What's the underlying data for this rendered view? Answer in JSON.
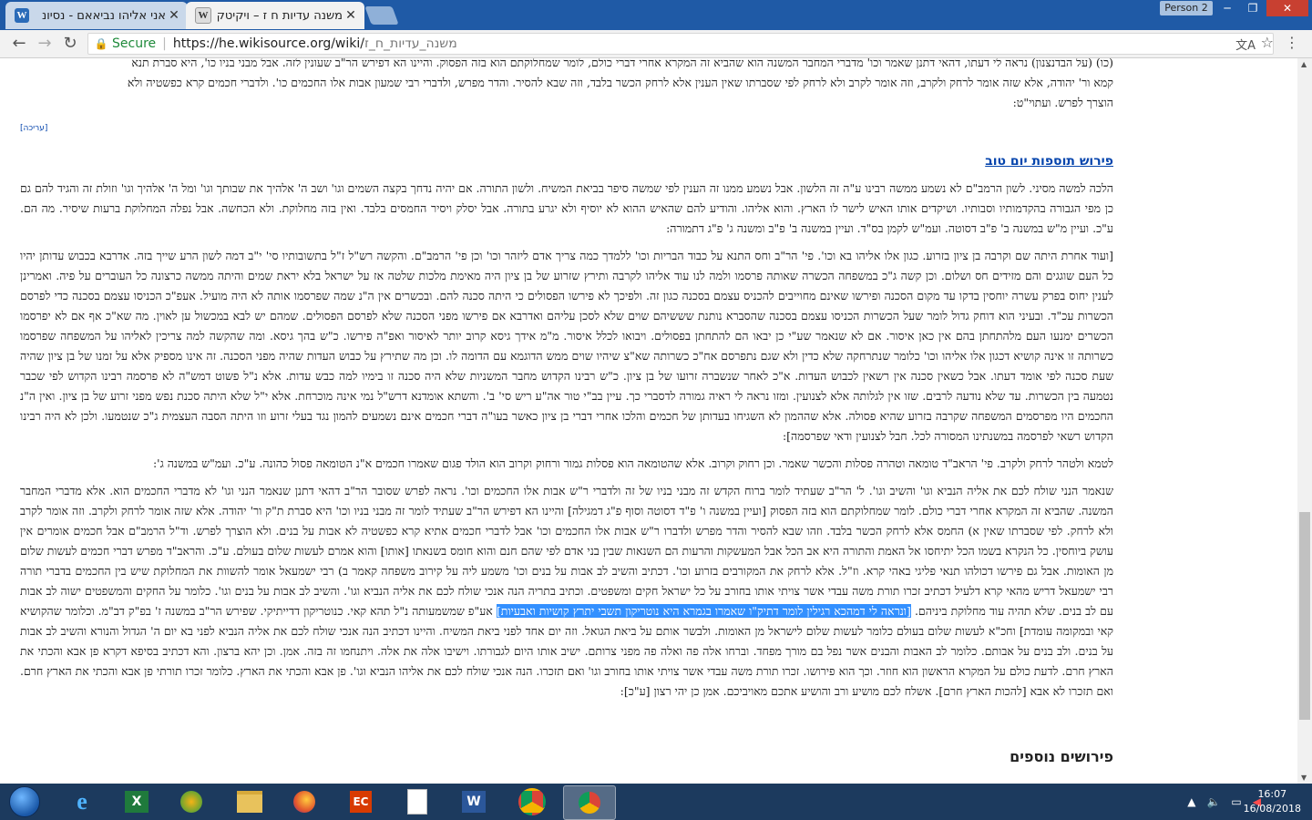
{
  "browser": {
    "tabs": [
      {
        "title": "אני אליהו נביאאם - נסיונ",
        "favicon": "W"
      },
      {
        "title": "משנה עדיות ח ז – ויקיטקסט",
        "favicon": "W"
      }
    ],
    "profile": "Person 2",
    "secure_label": "Secure",
    "url_host": "https://he.wikisource.org/wiki/",
    "url_path": "משנה_עדיות_ח_ז"
  },
  "content": {
    "intro_lines": [
      "(כו) (על הבדנצנון) נראה לי דעתו, דהאי דתנן שאמר וכו' מדברי המחבר המשנה הוא שהביא זה המקרא אחרי דברי כולם, לומר שמחלוקתם הוא בזה הפסוק. והיינו הא דפירש הר\"ב שעונין לזה. אבל מבני בניו כו', היא סברת תנא",
      "קמא ור' יהודה, אלא שזה אומר לרחק ולקרב, וזה אומר לקרב ולא לרחק לפי שסברתו שאין הענין אלא לרחק הכשר בלבד, וזה שבא להסיר. והדר מפרש, ולדברי רבי שמעון אבות אלו החכמים כו'. ולדברי חכמים קרא כפשטיה ולא",
      "הוצרך לפרש. ועתוי\"ט:"
    ],
    "edit_link": "[עריכה]",
    "heading": "פירוש תוספות יום טוב",
    "para1": "הלכה למשה מסיני. לשון הרמב\"ם לא נשמע ממשה רבינו ע\"ה זה הלשון. אבל נשמע ממנו זה הענין לפי שמשה סיפר בביאת המשיח. ולשון התורה. אם יהיה נדחך בקצה השמים וגו' ושב ה' אלהיך את שבותך וגו' ומל ה' אלהיך וגו' וזולת זה והגיד להם גם כן מפי הגבורה בהקדמותיו וסבותיו. ושיקדים אותו האיש לישר לו הארץ. והוא אליהו. והודיע להם שהאיש ההוא לא יוסיף ולא יגרע בתורה. אבל יסלק ויסיר החמסים בלבד. ואין בזה מחלוקת. ולא הכחשה. אבל נפלה המחלוקת ברעות שיסיר. מה הם. ע\"כ. ועיין מ\"ש במשנה ב' פ\"ב דסוטה. ועמ\"ש לקמן בס\"ד. ועיין במשנה ב' פ\"ב ומשנה ג' פ\"ג דתמורה:",
    "para2": "[ועוד אחרת היתה שם וקרבה בן ציון בזרוע. כגון אלו אליהו בא וכו'. פי' הר\"ב וחס התנא על כבוד הבריות וכו' ללמדך כמה צריך אדם ליזהר וכו' וכן פי' הרמב\"ם. והקשה רש\"ל ז\"ל בתשובותיו סי' י\"ב דמה לשון הרע שייך בזה. אדרבא בכבוש עדותן יהיו כל העם שוגגים והם מזידים חס ושלום. וכן קשה ג\"כ במשפחה הכשרה שאותה פרסמו ולמה לנו עוד אליהו לקרבה ותירץ שזרוע של בן ציון היה מאימת מלכות שלטה אז על ישראל בלא יראת שמים והיתה ממשה כרצונה כל העוברים על פיה. ואמרינן לענין יחוס בפרק עשרה יוחסין בדקו עד מקום הסכנה ופירשו שאינם מחוייבים להכניס עצמם בסכנה כגון זה. ולפיכך לא פירשו הפסולים כי היתה סכנה להם. ובכשרים אין ה\"נ שמה שפרסמו אותה לא היה מועיל. אעפ\"כ הכניסו עצמם בסכנה כדי לפרסם הכשרות עכ\"ד. ובעיני הוא דוחק גדול לומר שעל הכשרות הכניסו עצמם בסכנה שהסברא נותנת שששיהם שוים שלא לסכן עליהם ואדרבא אם פירשו מפני הסכנה שלא לפרסם הפסולים. שמהם יש לבא במכשול ען לאוין. מה שא\"כ אף אם לא יפרסמו הכשרים ימנעו העם מלהתחתן בהם אין כאן איסור. אם לא שנאמר שע\"י כן יבאו הם להתחתן בפסולים. ויבואו לכלל איסור. מ\"מ אידך גיסא קרוב יותר לאיסור ואפ\"ה פירשו. כ\"ש בהך גיסא. ומה שהקשה למה צריכין לאליהו על המשפחה שפרסמו כשרותה זו אינה קושיא דכגון אלו אליהו וכו' כלומר שנתרחקה שלא כדין ולא שגם נתפרסם אח\"כ כשרותה שא\"צ שיהיו שוים ממש הדוגמא עם הדומה לו. וכן מה שתירץ על כבוש העדות שהיה מפני הסכנה. זה אינו מספיק אלא על זמנו של בן ציון שהיה שעת סכנה לפי אומד דעתו. אבל כשאין סכנה אין רשאין לכבוש העדות. א\"כ לאחר שנשברה זרועו של בן ציון. כ\"ש רבינו הקדוש מחבר המשניות שלא היה סכנה זו בימיו למה כבש עדות. אלא נ\"ל פשוט דמש\"ה לא פרסמה רבינו הקדוש לפי שכבר נטמעה בין הכשרות. עד שלא נודעה לרבים. שזו אין לגלותה אלא לצנועין. ומזו נראה לי ראיה גמורה לדסברי כך. עיין בב\"י טור אה\"ע ריש סי' ב'. והשתא אומדנא דרש\"ל נמי אינה מוכרחת. אלא י\"ל שלא היתה סכנת נפש מפני זרוע של בן ציון. ואין ה\"נ החכמים היו מפרסמים המשפחה שקרבה בזרוע שהיא פסולה. אלא שההמון לא השגיחו בעדותן של חכמים והלכו אחרי דברי בן ציון כאשר בעו\"ה דברי חכמים אינם נשמעים להמון נגד בעלי זרוע וזו היתה הסבה העצמית ג\"כ שנטמעו. ולכן לא היה רבינו הקדוש רשאי לפרסמה במשנתינו המסורה לכל. חבל לצנועין ודאי שפרסמה]:",
    "para3": "לטמא ולטהר לרחק ולקרב. פי' הראב\"ד טומאה וטהרה פסלות והכשר שאמר. וכן רחוק וקרוב. אלא שהטומאה הוא פסלות גמור ורחוק וקרוב הוא הולד פגום שאמרו חכמים א\"נ הטומאה פסול כהונה. ע\"כ. ועמ\"ש במשנה ג':",
    "para4_before": "שנאמר הנני שולח לכם את אליה הנביא וגו' והשיב וגו'. ל' הר\"ב שעתיד לומר ברוח הקדש זה מבני בניו של זה ולדברי ר\"ש אבות אלו החכמים וכו'. נראה לפרש שסובר הר\"ב דהאי דתנן שנאמר הנני וגו' לא מדברי החכמים הוא. אלא מדברי המחבר המשנה. שהביא זה המקרא אחרי דברי כולם. לומר שמחלוקתם הוא בזה הפסוק [ועיין במשנה ו' פ\"ד דסוטה וסוף פ\"ג דמגילה] והיינו הא דפירש הר\"ב שעתיד לומר זה מבני בניו וכו' היא סברת ת\"ק ור' יהודה. אלא שזה אומר לרחק ולקרב. וזה אומר לקרב ולא לרחק. לפי שסברתו שאין א) החמס אלא לרחק הכשר בלבד. וזהו שבא להסיר והדר מפרש ולדברו ר\"ש אבות אלו החכמים וכו' אבל לדברי חכמים אתיא קרא כפשטיה לא אבות על בנים. ולא הוצרך לפרש. וד\"ל הרמב\"ם אבל חכמים אומרים אין עושק ביוחסין. כל הנקרא בשמו הכל יתיחסו אל האמת והתורה היא אב הכל אבל המעשקות והרעות הם השנאות שבין בני אדם לפי שהם חנם והוא חומס בשנאתו [אותו] והוא אמרם לעשות שלום בעולם. ע\"כ. והראב\"ד מפרש דברי חכמים לעשות שלום מן האומות. אבל גם פירשו דכולהו תנאי פליגי באהי קרא. וז\"ל. אלא לרחק את המקורבים בזרוע וכו'. דכתיב והשיב לב אבות על בנים וכו' משמע ליה על קירוב משפחה קאמר ב) רבי ישמעאל אומר להשוות את המחלוקת שיש בין החכמים בדברי תורה רבי ישמעאל דריש מהאי קרא דלעיל דכתיב זכרו תורת משה עבדי אשר צויתי אותו בחורב על כל ישראל חקים ומשפטים. וכתיב בתריה הנה אנכי שולח לכם את אליה הנביא וגו'. והשיב לב אבות על בנים וגו'. כלומר על החקים והמשפטים ישוה לב אבות עם לב בנים. שלא תהיה עוד מחלוקת ביניהם. ",
    "para4_highlight": "[ונראה לי דמהכא רגילין לומר דתיק\"ו שאמרו בגמרא היא נוטריקון תשבי יתרץ קושיות ואבעיות]",
    "para4_after": " אע\"פ שמשמעותה נ\"ל תהא קאי. כנוטריקון דדייתיקי. שפירש הר\"ב במשנה ז' בפ\"ק דב\"מ. וכלומר שהקושיא קאי ובמקומה עומדת] וחכ\"א לעשות שלום בעולם כלומר לעשות שלום לישראל מן האומות. ולבשר אותם על ביאת הגואל. וזה יום אחד לפני ביאת המשיח. והיינו דכתיב הנה אנכי שולח לכם את אליה הנביא לפני בא יום ה' הגדול והנורא והשיב לב אבות על בנים. ולב בנים על אבותם. כלומר לב האבות והבנים אשר נפל בם מורך מפחד. וברחו אלה פה ואלה פה מפני צרותם. ישיב אותו היום לגבורתו. וישיבו אלה את אלה. ויתנחמו זה בזה. אמן. וכן יהא ברצון. והא דכתיב בסיפא דקרא פן אבא והכתי את הארץ חרם. לדעת כולם על המקרא הראשון הוא חוזר. וכך הוא פירושו. זכרו תורת משה עבדי אשר צויתי אותו בחורב וגו' ואם תזכרו. הנה אנכי שולח לכם את אליהו הנביא וגו'. פן אבא והכתי את הארץ. כלומר זכרו תורתי פן אבא והכתי את הארץ חרם. ואם תזכרו לא אבא [להכות הארץ חרם]. אשלח לכם מושיע ורב והושיע אתכם מאויביכם. אמן כן יהי רצון [ע\"כ]:",
    "next_heading": "פירושים נוספים"
  },
  "taskbar": {
    "time": "16:07",
    "date": "16/08/2018"
  },
  "colors": {
    "tab_strip": "#1f5aa6",
    "link": "#0645ad",
    "selection": "#3390ff",
    "taskbar": "#1c3a5e"
  }
}
